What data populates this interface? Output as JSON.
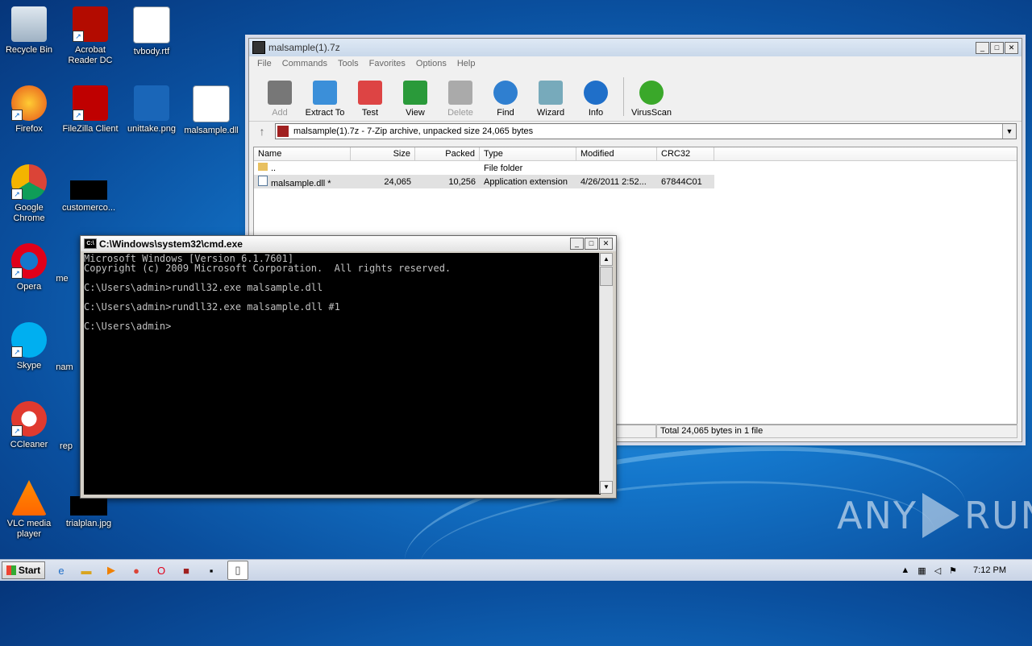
{
  "desktop": {
    "icons": [
      {
        "label": "Recycle Bin"
      },
      {
        "label": "Acrobat Reader DC"
      },
      {
        "label": "tvbody.rtf"
      },
      {
        "label": "Firefox"
      },
      {
        "label": "FileZilla Client"
      },
      {
        "label": "unittake.png"
      },
      {
        "label": "malsample.dll"
      },
      {
        "label": "Google Chrome"
      },
      {
        "label": "customerco..."
      },
      {
        "label": "Opera"
      },
      {
        "label": "me"
      },
      {
        "label": "Skype"
      },
      {
        "label": "nam"
      },
      {
        "label": "CCleaner"
      },
      {
        "label": "rep"
      },
      {
        "label": "VLC media player"
      },
      {
        "label": "trialplan.jpg"
      }
    ],
    "watermark": {
      "left": "ANY",
      "right": "RUN"
    }
  },
  "sevenzip": {
    "title": "malsample(1).7z",
    "menu": [
      "File",
      "Commands",
      "Tools",
      "Favorites",
      "Options",
      "Help"
    ],
    "toolbar": [
      {
        "label": "Add",
        "icon": "add-icon",
        "enabled": false
      },
      {
        "label": "Extract To",
        "icon": "extract-icon",
        "enabled": true
      },
      {
        "label": "Test",
        "icon": "test-icon",
        "enabled": true
      },
      {
        "label": "View",
        "icon": "view-icon",
        "enabled": true
      },
      {
        "label": "Delete",
        "icon": "delete-icon",
        "enabled": false
      },
      {
        "label": "Find",
        "icon": "find-icon",
        "enabled": true
      },
      {
        "label": "Wizard",
        "icon": "wizard-icon",
        "enabled": true
      },
      {
        "label": "Info",
        "icon": "info-icon",
        "enabled": true
      },
      {
        "label": "VirusScan",
        "icon": "virusscan-icon",
        "enabled": true
      }
    ],
    "address": "malsample(1).7z - 7-Zip archive, unpacked size 24,065 bytes",
    "columns": [
      "Name",
      "Size",
      "Packed",
      "Type",
      "Modified",
      "CRC32"
    ],
    "rows": [
      {
        "name": "..",
        "size": "",
        "packed": "",
        "type": "File folder",
        "modified": "",
        "crc": ""
      },
      {
        "name": "malsample.dll *",
        "size": "24,065",
        "packed": "10,256",
        "type": "Application extension",
        "modified": "4/26/2011 2:52...",
        "crc": "67844C01"
      }
    ],
    "status": "Total 24,065 bytes in 1 file"
  },
  "cmd": {
    "title": "C:\\Windows\\system32\\cmd.exe",
    "lines": [
      "Microsoft Windows [Version 6.1.7601]",
      "Copyright (c) 2009 Microsoft Corporation.  All rights reserved.",
      "",
      "C:\\Users\\admin>rundll32.exe malsample.dll",
      "",
      "C:\\Users\\admin>rundll32.exe malsample.dll #1",
      "",
      "C:\\Users\\admin>"
    ]
  },
  "taskbar": {
    "start": "Start",
    "clock": "7:12 PM"
  },
  "colors": {
    "accent": "#1477cc",
    "cmd_bg": "#000000",
    "cmd_fg": "#c0c0c0"
  }
}
